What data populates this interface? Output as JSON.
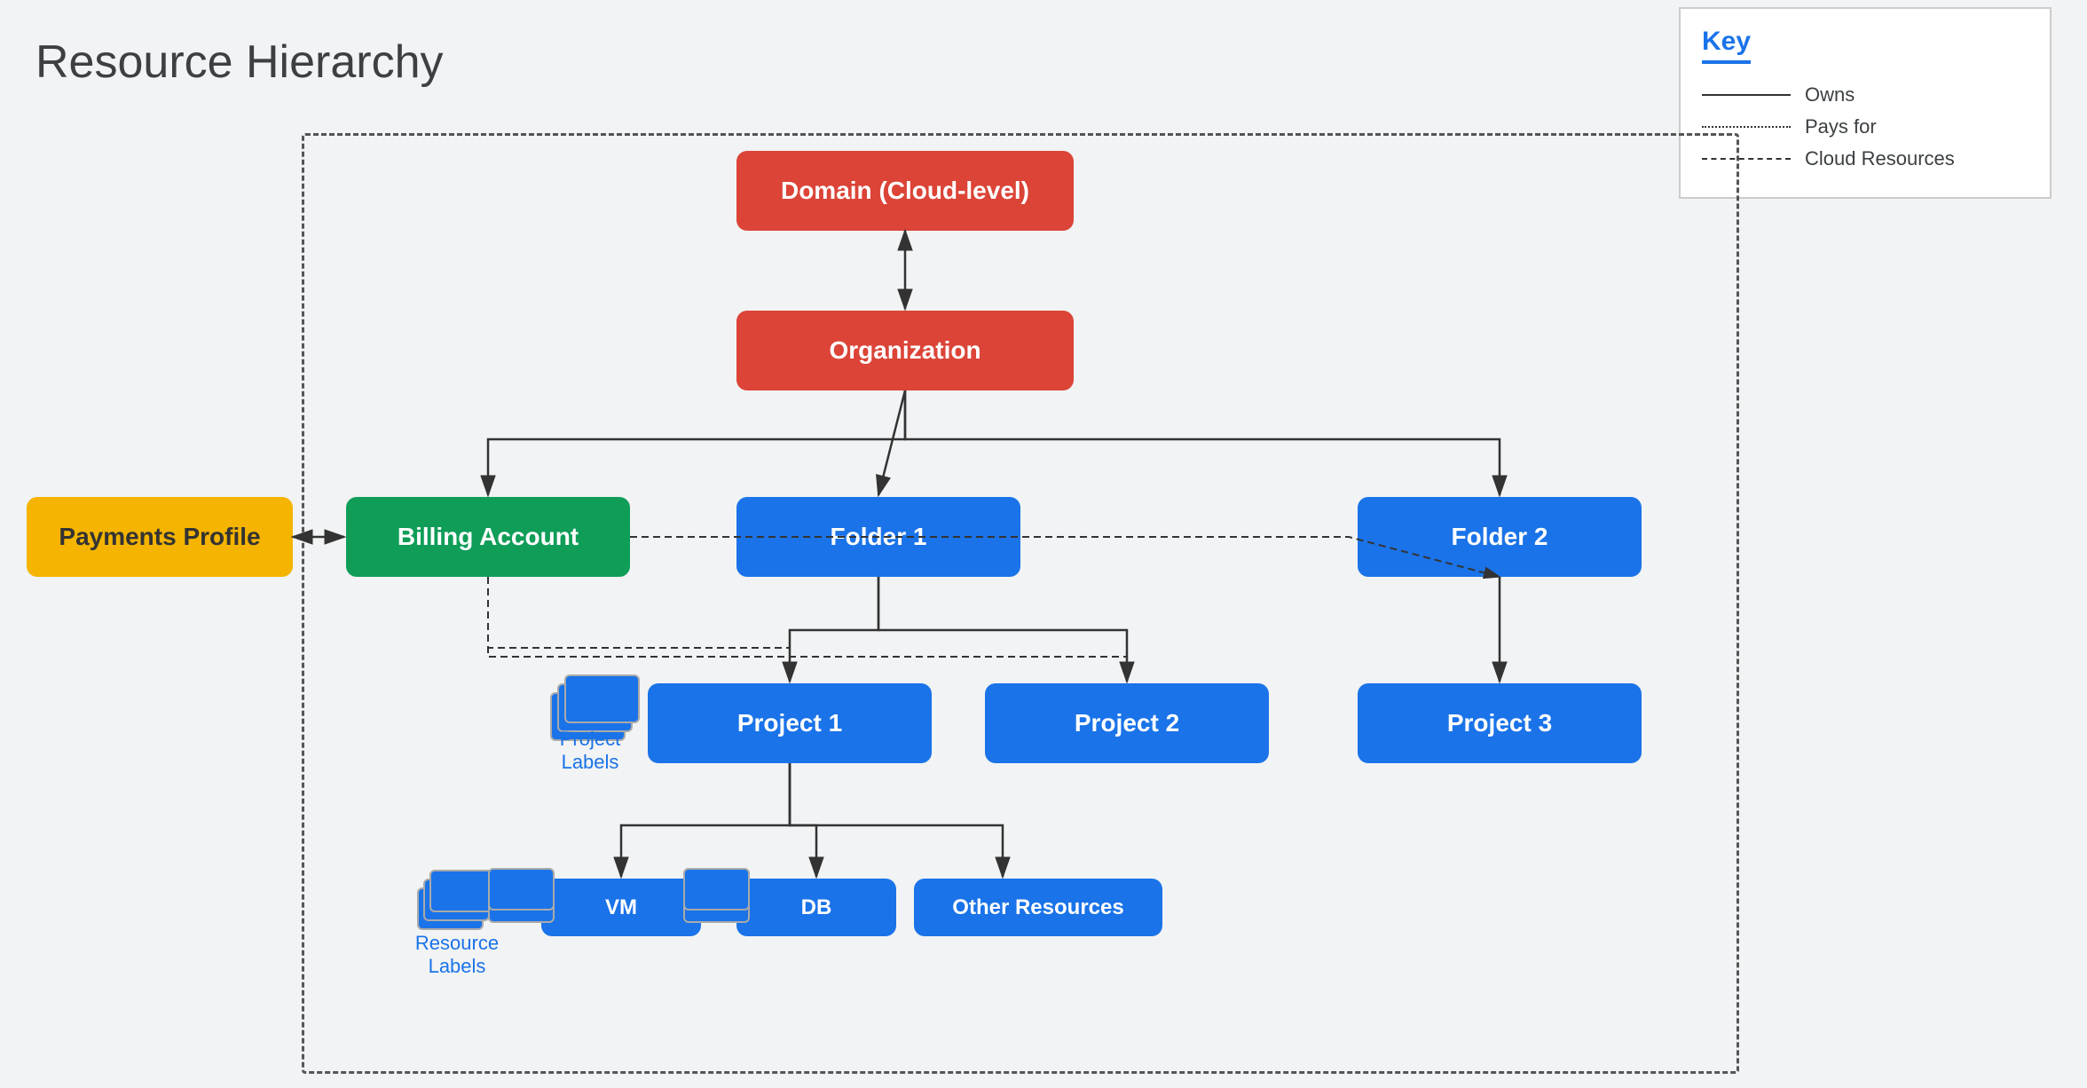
{
  "title": "Resource Hierarchy",
  "key": {
    "title": "Key",
    "items": [
      {
        "type": "solid",
        "label": "Owns"
      },
      {
        "type": "dotted",
        "label": "Pays for"
      },
      {
        "type": "dashed",
        "label": "Cloud Resources"
      }
    ]
  },
  "nodes": {
    "domain": "Domain (Cloud-level)",
    "organization": "Organization",
    "billing_account": "Billing Account",
    "payments_profile": "Payments Profile",
    "folder1": "Folder 1",
    "folder2": "Folder 2",
    "project1": "Project 1",
    "project2": "Project 2",
    "project3": "Project 3",
    "vm": "VM",
    "db": "DB",
    "other_resources": "Other Resources"
  },
  "labels": {
    "project_labels": "Project\nLabels",
    "resource_labels": "Resource\nLabels"
  }
}
